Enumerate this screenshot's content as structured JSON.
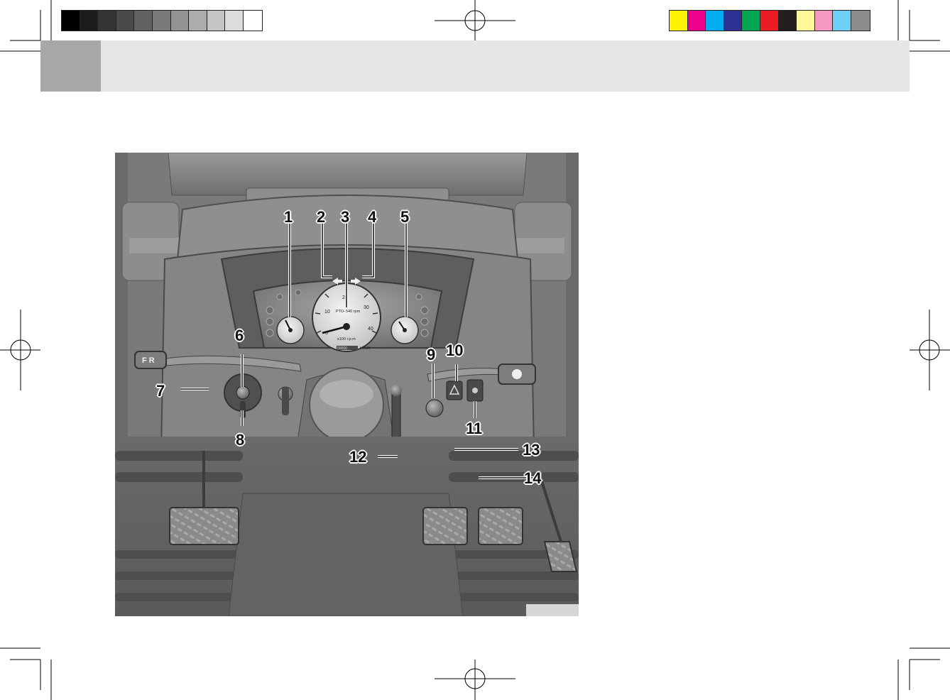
{
  "colors": {
    "header_bar": "#e6e6e6",
    "header_tab": "#a8a8a8",
    "grayscale_swatches": [
      "#000000",
      "#1c1c1c",
      "#333333",
      "#4a4a4a",
      "#616161",
      "#7a7a7a",
      "#939393",
      "#acacac",
      "#c4c4c4",
      "#dcdcdc",
      "#ffffff"
    ],
    "color_swatches": [
      "#fff200",
      "#ec008c",
      "#00aeef",
      "#2e3192",
      "#00a651",
      "#ed1c24",
      "#231f20",
      "#fff799",
      "#f49ac1",
      "#6dcff6",
      "#8c8c8c"
    ]
  },
  "figure": {
    "callouts": [
      "1",
      "2",
      "3",
      "4",
      "5",
      "6",
      "7",
      "8",
      "9",
      "10",
      "11",
      "12",
      "13",
      "14"
    ],
    "dash_text": {
      "pto": "PTO-",
      "rpm": "540 rpm",
      "scale": [
        "0",
        "10",
        "20",
        "30",
        "40"
      ],
      "unit": "x100 r.p.m",
      "hour": "HOUR",
      "hour_counter": "00000",
      "fr_lever": "F R"
    }
  }
}
